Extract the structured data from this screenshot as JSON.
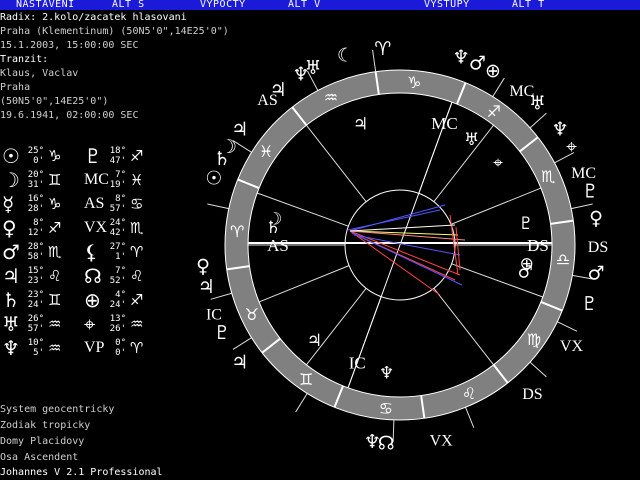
{
  "menu": [
    "NASTAVENI",
    "ALT S",
    "VYPOCTY",
    "ALT V",
    "VYSTUPY",
    "ALT T"
  ],
  "radix": {
    "title": "Radix: 2.kolo/zacatek hlasovani",
    "place": "Praha (Klementinum) (50N5'0\",14E25'0\")",
    "datetime": "15.1.2003, 15:00:00 SEC"
  },
  "tranzit": {
    "title": "Tranzit:",
    "name": "Klaus, Vaclav",
    "place": "Praha",
    "coords": "(50N5'0\",14E25'0\")",
    "datetime": "19.6.1941, 02:00:00 SEC"
  },
  "planets_left": [
    {
      "glyph": "☉",
      "deg": "25°",
      "min": "0'",
      "sign": "♑"
    },
    {
      "glyph": "☽",
      "deg": "20°",
      "min": "31'",
      "sign": "♊"
    },
    {
      "glyph": "☿",
      "deg": "16°",
      "min": "28'",
      "sign": "♑"
    },
    {
      "glyph": "♀",
      "deg": "8°",
      "min": "12'",
      "sign": "♐"
    },
    {
      "glyph": "♂",
      "deg": "28°",
      "min": "58'",
      "sign": "♏"
    },
    {
      "glyph": "♃",
      "deg": "15°",
      "min": "23'",
      "sign": "♌"
    },
    {
      "glyph": "♄",
      "deg": "23°",
      "min": "24'",
      "sign": "♊"
    },
    {
      "glyph": "♅",
      "deg": "26°",
      "min": "57'",
      "sign": "♒"
    },
    {
      "glyph": "♆",
      "deg": "10°",
      "min": "5'",
      "sign": "♒"
    }
  ],
  "planets_right": [
    {
      "glyph": "♇",
      "deg": "18°",
      "min": "47'",
      "sign": "♐"
    },
    {
      "glyph": "MC",
      "deg": "7°",
      "min": "19'",
      "sign": "♓"
    },
    {
      "glyph": "AS",
      "deg": "8°",
      "min": "57'",
      "sign": "♋"
    },
    {
      "glyph": "VX",
      "deg": "24°",
      "min": "42'",
      "sign": "♏"
    },
    {
      "glyph": "⚸",
      "deg": "27°",
      "min": "1'",
      "sign": "♈"
    },
    {
      "glyph": "☊",
      "deg": "7°",
      "min": "52'",
      "sign": "♌"
    },
    {
      "glyph": "⊕",
      "deg": "4°",
      "min": "24'",
      "sign": "♐"
    },
    {
      "glyph": "⌖",
      "deg": "13°",
      "min": "26'",
      "sign": "♒"
    },
    {
      "glyph": "VP",
      "deg": "0°",
      "min": "0'",
      "sign": "♈"
    }
  ],
  "footer": [
    "System geocentricky",
    "Zodiak tropicky",
    "Domy Placidovy",
    "Osa Ascendent",
    "Johannes V 2.1 Professional"
  ],
  "wheel": {
    "zodiac_order": [
      "♈",
      "♉",
      "♊",
      "♋",
      "♌",
      "♍",
      "♎",
      "♏",
      "♐",
      "♑",
      "♒",
      "♓"
    ],
    "axis_labels": {
      "as": "AS",
      "ds": "DS",
      "mc": "MC",
      "ic": "IC"
    },
    "outer_labels": [
      {
        "t": "♃",
        "ang": 128
      },
      {
        "t": "AS",
        "ang": 132
      },
      {
        "t": "♆",
        "ang": 120
      },
      {
        "t": "♅",
        "ang": 116
      },
      {
        "t": "☾",
        "ang": 106
      },
      {
        "t": "♈",
        "ang": 95
      },
      {
        "t": "♂",
        "ang": 67
      },
      {
        "t": "⊕",
        "ang": 62
      },
      {
        "t": "♃",
        "ang": 144
      },
      {
        "t": "☉",
        "ang": 160
      },
      {
        "t": "☽",
        "ang": 150
      },
      {
        "t": "♄",
        "ang": 154
      },
      {
        "t": "♇",
        "ang": 206
      },
      {
        "t": "IC",
        "ang": 200
      },
      {
        "t": "♀",
        "ang": 186
      },
      {
        "t": "♃",
        "ang": 192
      },
      {
        "t": "♃",
        "ang": 216
      },
      {
        "t": "♆",
        "ang": 262
      },
      {
        "t": "☊",
        "ang": 266
      },
      {
        "t": "VX",
        "ang": 282
      },
      {
        "t": "DS",
        "ang": 312
      },
      {
        "t": "VX",
        "ang": 330
      },
      {
        "t": "♇",
        "ang": 343
      },
      {
        "t": "DS",
        "ang": 0
      },
      {
        "t": "♀",
        "ang": 8
      },
      {
        "t": "♂",
        "ang": 352
      },
      {
        "t": "♇",
        "ang": 16
      },
      {
        "t": "MC",
        "ang": 22
      },
      {
        "t": "⌖",
        "ang": 30
      },
      {
        "t": "♅",
        "ang": 46
      },
      {
        "t": "MC",
        "ang": 52
      },
      {
        "t": "♆",
        "ang": 36
      },
      {
        "t": "♆",
        "ang": 72
      }
    ]
  },
  "colors": {
    "menubar": "#1a1ad8",
    "ring": "#808080",
    "background": "#000000"
  }
}
